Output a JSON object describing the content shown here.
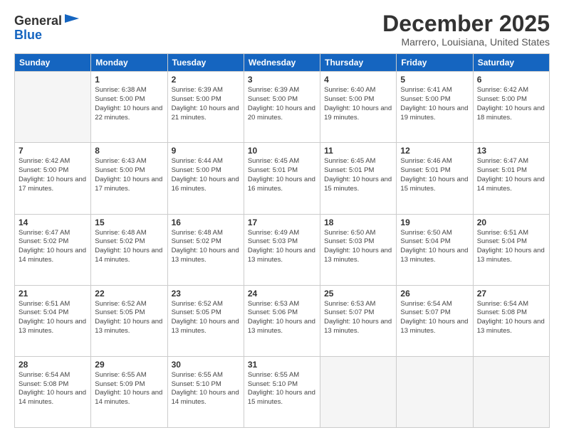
{
  "header": {
    "logo_line1": "General",
    "logo_line2": "Blue",
    "month": "December 2025",
    "location": "Marrero, Louisiana, United States"
  },
  "days_of_week": [
    "Sunday",
    "Monday",
    "Tuesday",
    "Wednesday",
    "Thursday",
    "Friday",
    "Saturday"
  ],
  "weeks": [
    [
      {
        "day": "",
        "empty": true
      },
      {
        "day": "1",
        "sunrise": "6:38 AM",
        "sunset": "5:00 PM",
        "daylight": "10 hours and 22 minutes."
      },
      {
        "day": "2",
        "sunrise": "6:39 AM",
        "sunset": "5:00 PM",
        "daylight": "10 hours and 21 minutes."
      },
      {
        "day": "3",
        "sunrise": "6:39 AM",
        "sunset": "5:00 PM",
        "daylight": "10 hours and 20 minutes."
      },
      {
        "day": "4",
        "sunrise": "6:40 AM",
        "sunset": "5:00 PM",
        "daylight": "10 hours and 19 minutes."
      },
      {
        "day": "5",
        "sunrise": "6:41 AM",
        "sunset": "5:00 PM",
        "daylight": "10 hours and 19 minutes."
      },
      {
        "day": "6",
        "sunrise": "6:42 AM",
        "sunset": "5:00 PM",
        "daylight": "10 hours and 18 minutes."
      }
    ],
    [
      {
        "day": "7",
        "sunrise": "6:42 AM",
        "sunset": "5:00 PM",
        "daylight": "10 hours and 17 minutes."
      },
      {
        "day": "8",
        "sunrise": "6:43 AM",
        "sunset": "5:00 PM",
        "daylight": "10 hours and 17 minutes."
      },
      {
        "day": "9",
        "sunrise": "6:44 AM",
        "sunset": "5:00 PM",
        "daylight": "10 hours and 16 minutes."
      },
      {
        "day": "10",
        "sunrise": "6:45 AM",
        "sunset": "5:01 PM",
        "daylight": "10 hours and 16 minutes."
      },
      {
        "day": "11",
        "sunrise": "6:45 AM",
        "sunset": "5:01 PM",
        "daylight": "10 hours and 15 minutes."
      },
      {
        "day": "12",
        "sunrise": "6:46 AM",
        "sunset": "5:01 PM",
        "daylight": "10 hours and 15 minutes."
      },
      {
        "day": "13",
        "sunrise": "6:47 AM",
        "sunset": "5:01 PM",
        "daylight": "10 hours and 14 minutes."
      }
    ],
    [
      {
        "day": "14",
        "sunrise": "6:47 AM",
        "sunset": "5:02 PM",
        "daylight": "10 hours and 14 minutes."
      },
      {
        "day": "15",
        "sunrise": "6:48 AM",
        "sunset": "5:02 PM",
        "daylight": "10 hours and 14 minutes."
      },
      {
        "day": "16",
        "sunrise": "6:48 AM",
        "sunset": "5:02 PM",
        "daylight": "10 hours and 13 minutes."
      },
      {
        "day": "17",
        "sunrise": "6:49 AM",
        "sunset": "5:03 PM",
        "daylight": "10 hours and 13 minutes."
      },
      {
        "day": "18",
        "sunrise": "6:50 AM",
        "sunset": "5:03 PM",
        "daylight": "10 hours and 13 minutes."
      },
      {
        "day": "19",
        "sunrise": "6:50 AM",
        "sunset": "5:04 PM",
        "daylight": "10 hours and 13 minutes."
      },
      {
        "day": "20",
        "sunrise": "6:51 AM",
        "sunset": "5:04 PM",
        "daylight": "10 hours and 13 minutes."
      }
    ],
    [
      {
        "day": "21",
        "sunrise": "6:51 AM",
        "sunset": "5:04 PM",
        "daylight": "10 hours and 13 minutes."
      },
      {
        "day": "22",
        "sunrise": "6:52 AM",
        "sunset": "5:05 PM",
        "daylight": "10 hours and 13 minutes."
      },
      {
        "day": "23",
        "sunrise": "6:52 AM",
        "sunset": "5:05 PM",
        "daylight": "10 hours and 13 minutes."
      },
      {
        "day": "24",
        "sunrise": "6:53 AM",
        "sunset": "5:06 PM",
        "daylight": "10 hours and 13 minutes."
      },
      {
        "day": "25",
        "sunrise": "6:53 AM",
        "sunset": "5:07 PM",
        "daylight": "10 hours and 13 minutes."
      },
      {
        "day": "26",
        "sunrise": "6:54 AM",
        "sunset": "5:07 PM",
        "daylight": "10 hours and 13 minutes."
      },
      {
        "day": "27",
        "sunrise": "6:54 AM",
        "sunset": "5:08 PM",
        "daylight": "10 hours and 13 minutes."
      }
    ],
    [
      {
        "day": "28",
        "sunrise": "6:54 AM",
        "sunset": "5:08 PM",
        "daylight": "10 hours and 14 minutes."
      },
      {
        "day": "29",
        "sunrise": "6:55 AM",
        "sunset": "5:09 PM",
        "daylight": "10 hours and 14 minutes."
      },
      {
        "day": "30",
        "sunrise": "6:55 AM",
        "sunset": "5:10 PM",
        "daylight": "10 hours and 14 minutes."
      },
      {
        "day": "31",
        "sunrise": "6:55 AM",
        "sunset": "5:10 PM",
        "daylight": "10 hours and 15 minutes."
      },
      {
        "day": "",
        "empty": true
      },
      {
        "day": "",
        "empty": true
      },
      {
        "day": "",
        "empty": true
      }
    ]
  ]
}
